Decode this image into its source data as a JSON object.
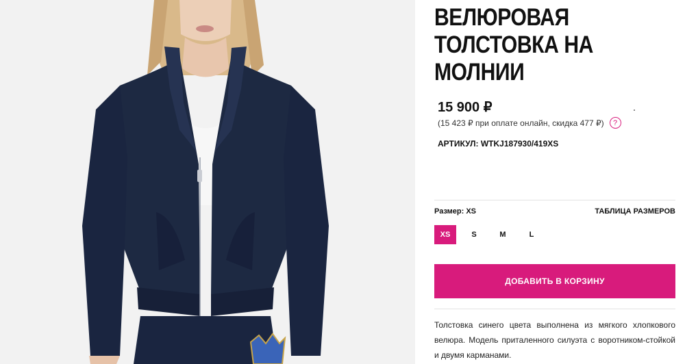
{
  "product": {
    "title": "ВЕЛЮРОВАЯ ТОЛСТОВКА НА МОЛНИИ",
    "price": "15 900 ₽",
    "online_price_note": "(15 423 ₽ при оплате онлайн, скидка 477 ₽)",
    "help_icon": "question-circle-icon",
    "sku_label": "АРТИКУЛ:",
    "sku_value": "WTKJ187930/419XS"
  },
  "size_picker": {
    "label": "Размер: XS",
    "chart_link": "ТАБЛИЦА РАЗМЕРОВ",
    "sizes": [
      "XS",
      "S",
      "M",
      "L"
    ],
    "selected": "XS"
  },
  "cart": {
    "button_label": "ДОБАВИТЬ В КОРЗИНУ"
  },
  "description": "Толстовка синего цвета выполнена из мягкого хлопкового велюра. Модель приталенного силуэта с воротником-стойкой и двумя карманами.",
  "colors": {
    "accent": "#d81b7c",
    "garment": "#1d2942",
    "background": "#f2f2f2"
  }
}
